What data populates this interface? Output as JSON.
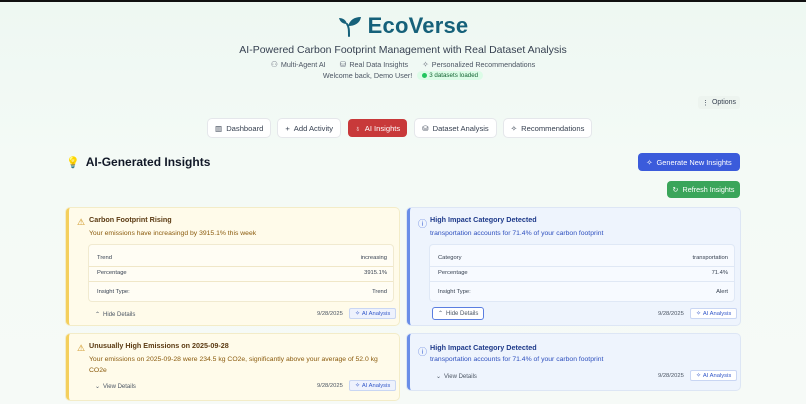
{
  "header": {
    "brand": "EcoVerse",
    "subtitle": "AI-Powered Carbon Footprint Management with Real Dataset Analysis",
    "features": [
      {
        "icon": "brain-icon",
        "label": "Multi-Agent AI"
      },
      {
        "icon": "database-icon",
        "label": "Real Data Insights"
      },
      {
        "icon": "sparkles-icon",
        "label": "Personalized Recommendations"
      }
    ],
    "welcome": "Welcome back, Demo User!",
    "datasets_badge": "3 datasets loaded",
    "options_label": "Options"
  },
  "tabs": [
    {
      "label": "Dashboard",
      "icon": "bar-chart-icon",
      "active": false
    },
    {
      "label": "Add Activity",
      "icon": "plus-icon",
      "active": false
    },
    {
      "label": "AI Insights",
      "icon": "lightbulb-icon",
      "active": true
    },
    {
      "label": "Dataset Analysis",
      "icon": "database-icon",
      "active": false
    },
    {
      "label": "Recommendations",
      "icon": "sparkles-icon",
      "active": false
    }
  ],
  "section": {
    "title": "AI-Generated Insights",
    "generate_label": "Generate New Insights",
    "refresh_label": "Refresh Insights"
  },
  "cards": [
    {
      "title": "Carbon Footprint Rising",
      "description": "Your emissions have increasingd by 3915.1% this week",
      "details": [
        {
          "key": "Trend",
          "value": "increasing"
        },
        {
          "key": "Percentage",
          "value": "3915.1%"
        },
        {
          "key": "Insight Type:",
          "value": "Trend"
        }
      ],
      "toggle": "Hide Details",
      "date": "9/28/2025",
      "ai_label": "AI Analysis"
    },
    {
      "title": "High Impact Category Detected",
      "description": "transportation accounts for 71.4% of your carbon footprint",
      "details": [
        {
          "key": "Category",
          "value": "transportation"
        },
        {
          "key": "Percentage",
          "value": "71.4%"
        },
        {
          "key": "Insight Type:",
          "value": "Alert"
        }
      ],
      "toggle": "Hide Details",
      "date": "9/28/2025",
      "ai_label": "AI Analysis"
    },
    {
      "title": "Unusually High Emissions on 2025-09-28",
      "description_line1": "Your emissions on 2025-09-28 were 234.5 kg CO2e, significantly above your average of 52.0 kg",
      "description_line2": "CO2e",
      "toggle": "View Details",
      "date": "9/28/2025",
      "ai_label": "AI Analysis"
    },
    {
      "title": "High Impact Category Detected",
      "description": "transportation accounts for 71.4% of your carbon footprint",
      "toggle": "View Details",
      "date": "9/28/2025",
      "ai_label": "AI Analysis"
    }
  ]
}
